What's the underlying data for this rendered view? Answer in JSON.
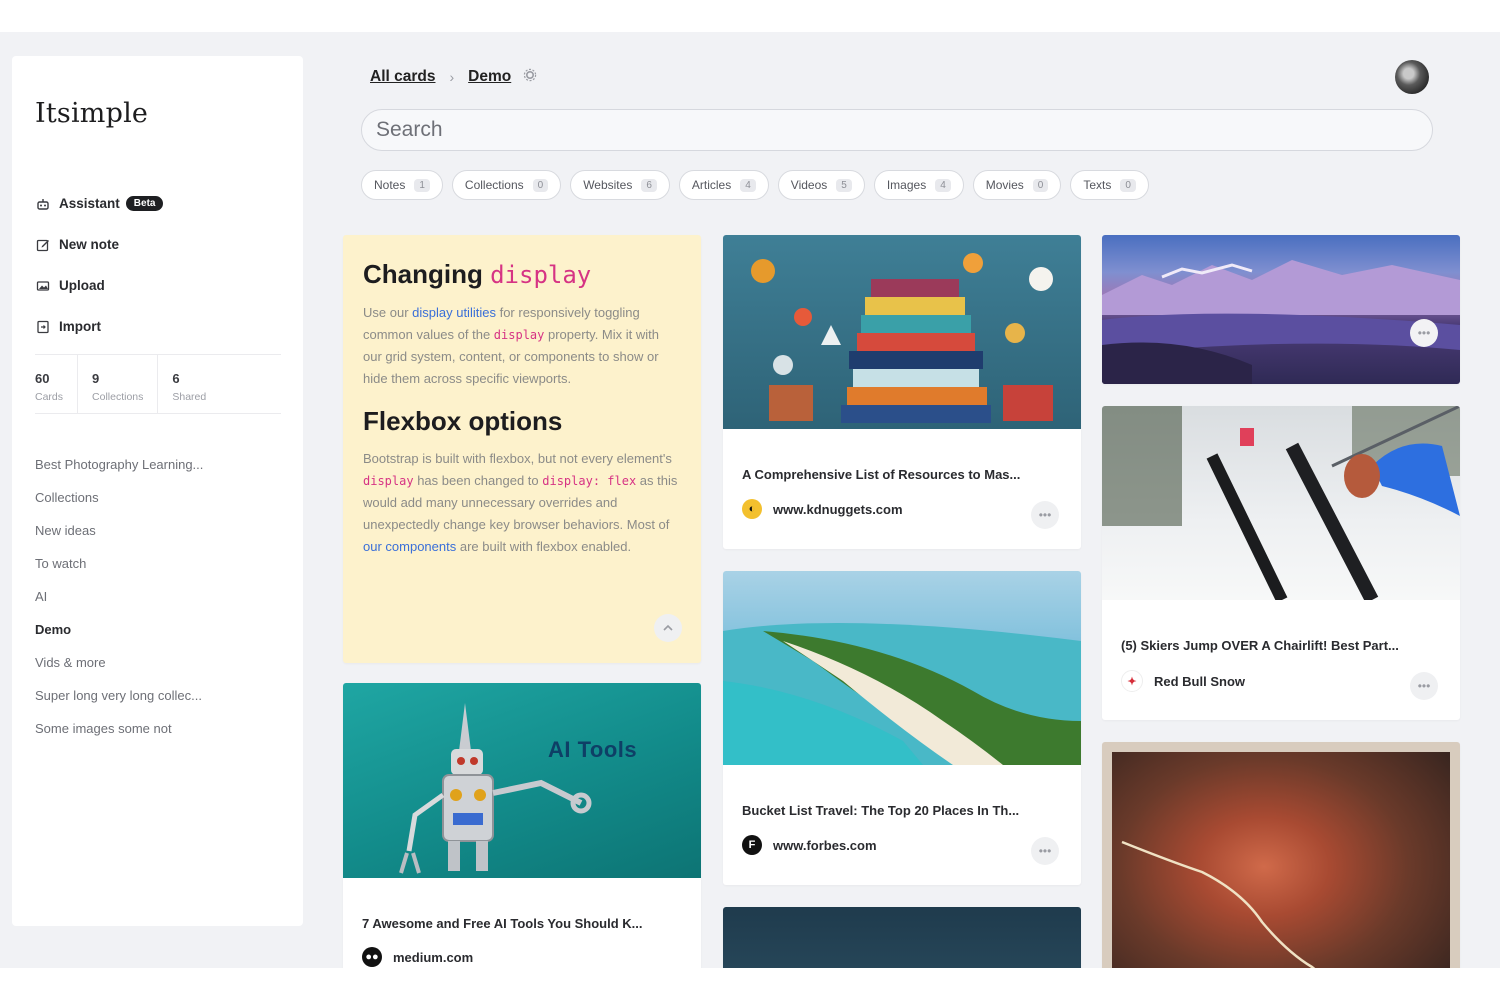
{
  "sidebar": {
    "logo": "Itsimple",
    "actions": [
      {
        "label": "Assistant",
        "badge": "Beta",
        "icon": "assistant-icon"
      },
      {
        "label": "New note",
        "icon": "edit-icon"
      },
      {
        "label": "Upload",
        "icon": "upload-icon"
      },
      {
        "label": "Import",
        "icon": "import-icon"
      }
    ],
    "stats": [
      {
        "value": "60",
        "label": "Cards"
      },
      {
        "value": "9",
        "label": "Collections"
      },
      {
        "value": "6",
        "label": "Shared"
      }
    ],
    "collections": [
      "Best Photography Learning...",
      "Collections",
      "New ideas",
      "To watch",
      "AI",
      "Demo",
      "Vids & more",
      "Super long very long collec...",
      "Some images some not"
    ],
    "active_collection": "Demo"
  },
  "header": {
    "breadcrumb": [
      "All cards",
      "Demo"
    ],
    "breadcrumb_separator": "›",
    "settings_icon": "gear-icon"
  },
  "search": {
    "placeholder": "Search"
  },
  "filters": [
    {
      "label": "Notes",
      "count": "1"
    },
    {
      "label": "Collections",
      "count": "0"
    },
    {
      "label": "Websites",
      "count": "6"
    },
    {
      "label": "Articles",
      "count": "4"
    },
    {
      "label": "Videos",
      "count": "5"
    },
    {
      "label": "Images",
      "count": "4"
    },
    {
      "label": "Movies",
      "count": "0"
    },
    {
      "label": "Texts",
      "count": "0"
    }
  ],
  "note": {
    "heading1": "Changing ",
    "heading1_code": "display",
    "p1_a": "Use our ",
    "p1_link": "display utilities",
    "p1_b": " for responsively toggling common values of the ",
    "p1_code": "display",
    "p1_c": " property. Mix it with our grid system, content, or components to show or hide them across specific viewports.",
    "heading2": "Flexbox options",
    "p2_a": "Bootstrap is built with flexbox, but not every element's ",
    "p2_code1": "display",
    "p2_b": " has been changed to ",
    "p2_code2": "display: flex",
    "p2_c": " as this would add many unnecessary overrides and unexpectedly change key browser behaviors. Most of ",
    "p2_link": "our components",
    "p2_d": " are built with flexbox enabled.",
    "collapse_icon": "chevron-up-icon"
  },
  "cards": {
    "ai_tools": {
      "image_text": "AI Tools",
      "title": "7 Awesome and Free AI Tools You Should K...",
      "site": "medium.com"
    },
    "kdnuggets": {
      "title": "A Comprehensive List of Resources to Mas...",
      "site": "www.kdnuggets.com"
    },
    "forbes": {
      "title": "Bucket List Travel: The Top 20 Places In Th...",
      "site": "www.forbes.com"
    },
    "skiers": {
      "title": "(5) Skiers Jump OVER A Chairlift! Best Part...",
      "site": "Red Bull Snow"
    }
  },
  "colors": {
    "accent_code": "#d63384",
    "link": "#3a6fd8",
    "note_bg": "#fdf2cc",
    "app_bg": "#f1f2f5"
  }
}
